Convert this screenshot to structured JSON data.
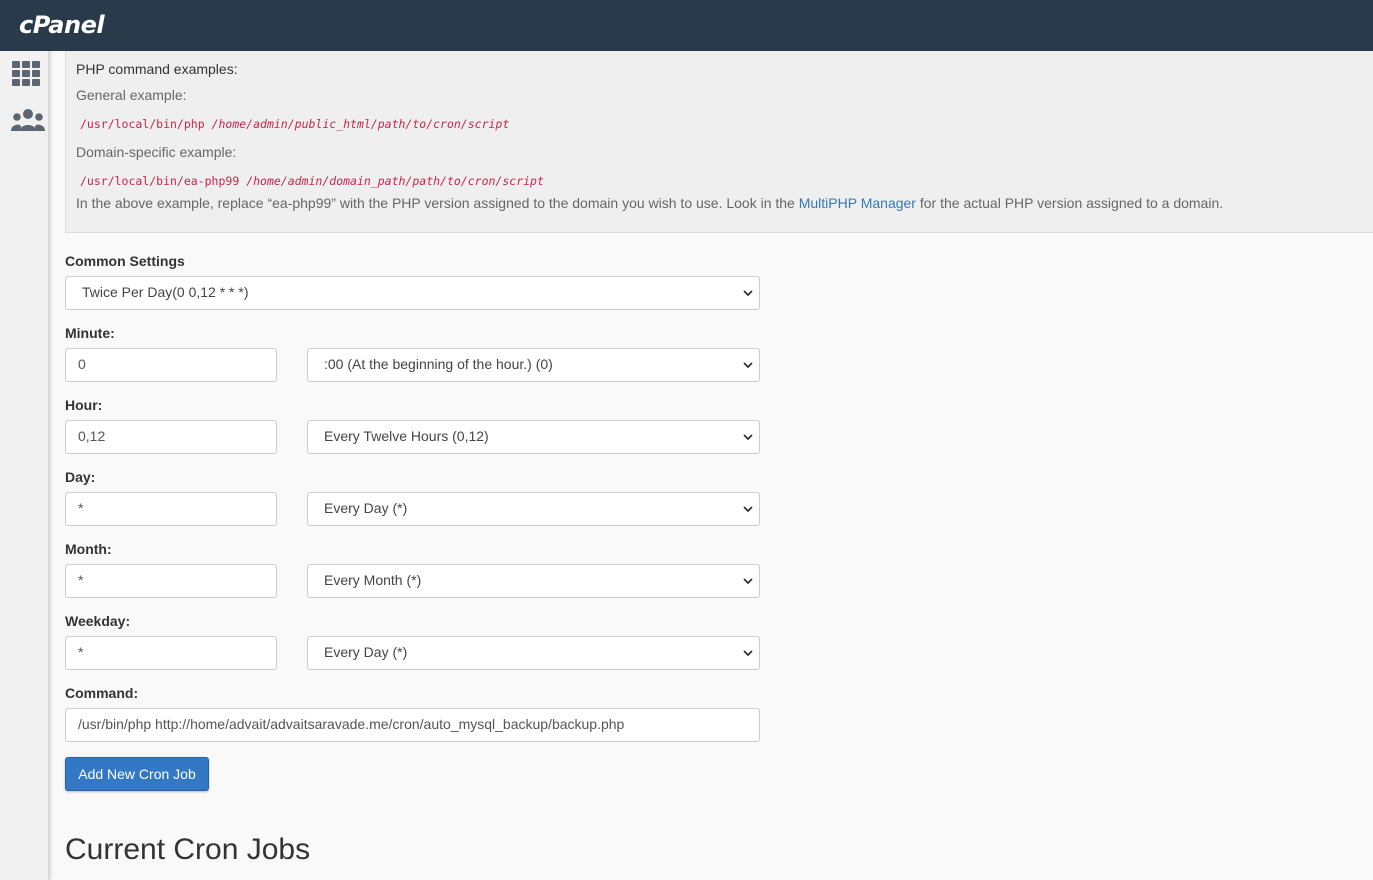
{
  "app": {
    "logo_text": "cPanel"
  },
  "sidebar": {
    "items": [
      {
        "icon": "grid-icon"
      },
      {
        "icon": "users-icon"
      }
    ]
  },
  "examples": {
    "title": "PHP command examples:",
    "general_label": "General example:",
    "general_cmd": "/usr/local/bin/php",
    "general_arg": "/home/admin/public_html/path/to/cron/script",
    "domain_label": "Domain-specific example:",
    "domain_cmd": "/usr/local/bin/ea-php99",
    "domain_arg": "/home/admin/domain_path/path/to/cron/script",
    "note_before": "In the above example, replace “ea-php99” with the PHP version assigned to the domain you wish to use. Look in the ",
    "note_link": "MultiPHP Manager",
    "note_after": " for the actual PHP version assigned to a domain."
  },
  "form": {
    "common_settings": {
      "label": "Common Settings",
      "value": "Twice Per Day(0 0,12 * * *)"
    },
    "minute": {
      "label": "Minute:",
      "value": "0",
      "select": ":00 (At the beginning of the hour.) (0)"
    },
    "hour": {
      "label": "Hour:",
      "value": "0,12",
      "select": "Every Twelve Hours (0,12)"
    },
    "day": {
      "label": "Day:",
      "value": "*",
      "select": "Every Day (*)"
    },
    "month": {
      "label": "Month:",
      "value": "*",
      "select": "Every Month (*)"
    },
    "weekday": {
      "label": "Weekday:",
      "value": "*",
      "select": "Every Day (*)"
    },
    "command": {
      "label": "Command:",
      "value": "/usr/bin/php http://home/advait/advaitsaravade.me/cron/auto_mysql_backup/backup.php"
    },
    "submit_label": "Add New Cron Job"
  },
  "current_jobs": {
    "heading": "Current Cron Jobs"
  },
  "colors": {
    "topbar": "#293a4a",
    "link": "#337ab7",
    "code": "#c7254e",
    "button": "#3278c4"
  }
}
